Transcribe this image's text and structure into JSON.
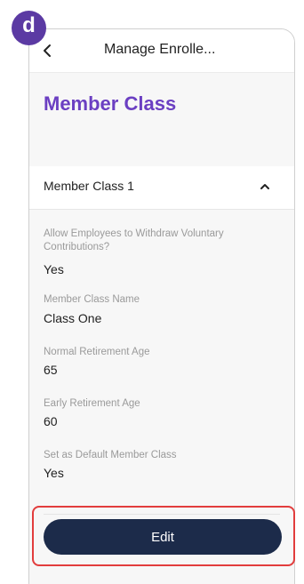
{
  "figure_label": "d",
  "header": {
    "title": "Manage Enrolle..."
  },
  "page": {
    "title": "Member Class"
  },
  "section": {
    "title": "Member Class 1"
  },
  "fields": [
    {
      "label": "Allow Employees to Withdraw Voluntary Contributions?",
      "value": "Yes"
    },
    {
      "label": "Member Class Name",
      "value": "Class One"
    },
    {
      "label": "Normal Retirement Age",
      "value": "65"
    },
    {
      "label": "Early Retirement Age",
      "value": "60"
    },
    {
      "label": "Set as Default Member Class",
      "value": "Yes"
    }
  ],
  "actions": {
    "edit_label": "Edit"
  },
  "colors": {
    "accent": "#6b3fc2",
    "button": "#1c2b4a",
    "highlight": "#e23d3d",
    "badge": "#5b3aa3"
  },
  "icons": {
    "back": "chevron-left-icon",
    "collapse": "chevron-up-icon"
  }
}
